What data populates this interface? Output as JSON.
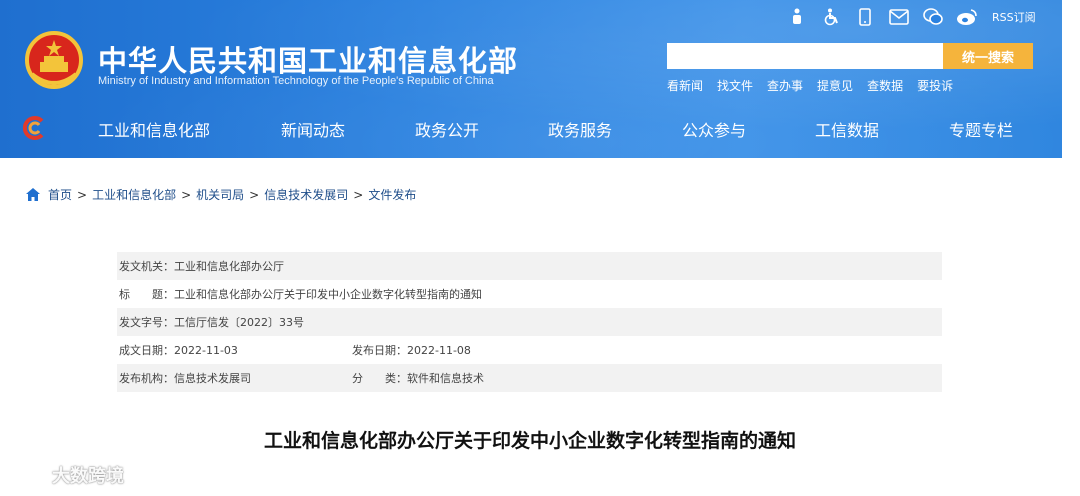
{
  "header": {
    "title": "中华人民共和国工业和信息化部",
    "subtitle": "Ministry of Industry and Information Technology of the People's Republic of China",
    "top_icons": [
      "accessibility-figure-icon",
      "wheelchair-icon",
      "mobile-icon",
      "mail-icon",
      "wechat-icon",
      "weibo-icon"
    ],
    "rss_label": "RSS订阅",
    "search": {
      "placeholder": "",
      "button_label": "统一搜索"
    },
    "quick_links": [
      "看新闻",
      "找文件",
      "查办事",
      "提意见",
      "查数据",
      "要投诉"
    ]
  },
  "nav": {
    "items": [
      "工业和信息化部",
      "新闻动态",
      "政务公开",
      "政务服务",
      "公众参与",
      "工信数据",
      "专题专栏"
    ]
  },
  "breadcrumb": [
    "首页",
    "工业和信息化部",
    "机关司局",
    "信息技术发展司",
    "文件发布"
  ],
  "info": {
    "issuer_label": "发文机关：",
    "issuer": "工业和信息化部办公厅",
    "title_label": "标　　题：",
    "title": "工业和信息化部办公厅关于印发中小企业数字化转型指南的通知",
    "doc_no_label": "发文字号：",
    "doc_no": "工信厅信发〔2022〕33号",
    "created_label": "成文日期：",
    "created": "2022-11-03",
    "published_label": "发布日期：",
    "published": "2022-11-08",
    "org_label": "发布机构：",
    "org": "信息技术发展司",
    "category_label": "分　　类：",
    "category": "软件和信息技术"
  },
  "document_title": "工业和信息化部办公厅关于印发中小企业数字化转型指南的通知",
  "watermark": "大数跨境",
  "colors": {
    "header_blue": "#2b82e0",
    "search_orange": "#f5b43c",
    "link_blue": "#1f4e8a"
  }
}
